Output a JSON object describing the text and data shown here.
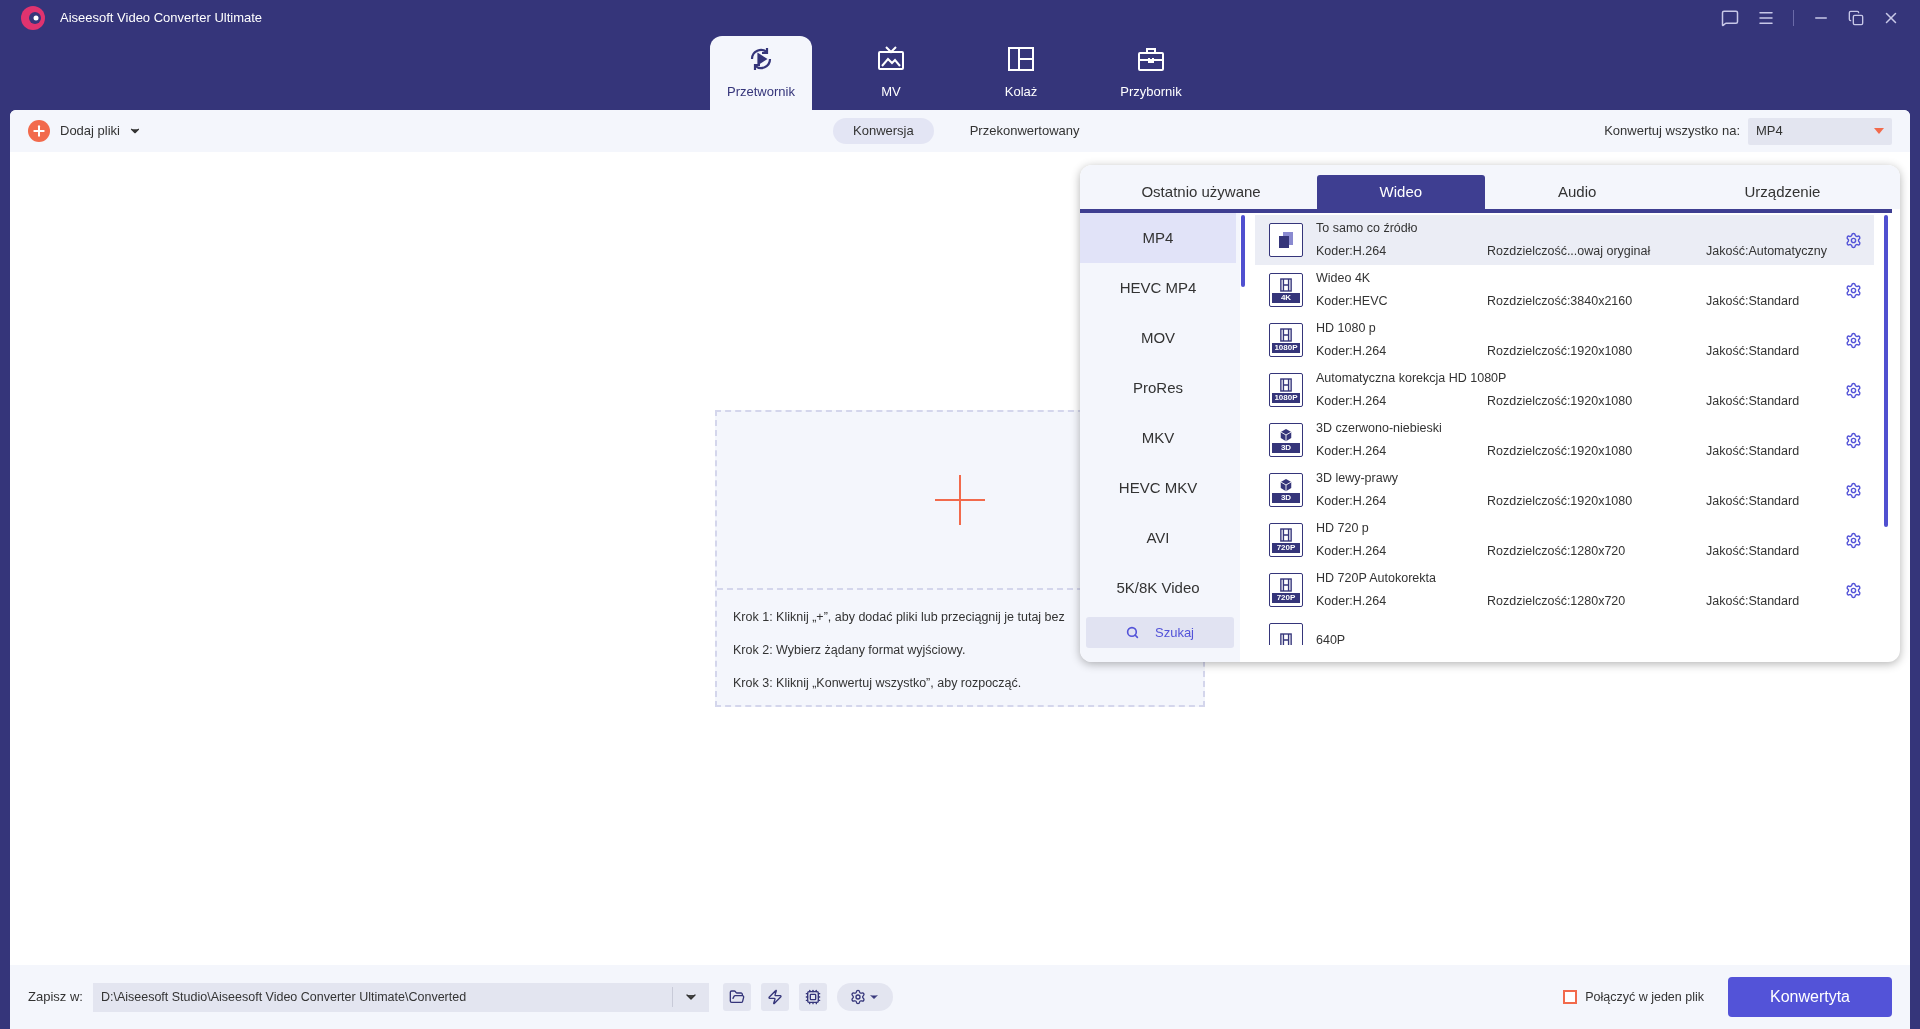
{
  "window": {
    "title": "Aiseesoft Video Converter Ultimate"
  },
  "nav_tabs": [
    {
      "label": "Przetwornik",
      "kind": "convert",
      "selected": true
    },
    {
      "label": "MV",
      "kind": "tv",
      "selected": false
    },
    {
      "label": "Kolaż",
      "kind": "collage",
      "selected": false
    },
    {
      "label": "Przybornik",
      "kind": "toolbox",
      "selected": false
    }
  ],
  "toolbar": {
    "add_files": "Dodaj pliki",
    "mode_tabs": [
      {
        "label": "Konwersja",
        "selected": true
      },
      {
        "label": "Przekonwertowany",
        "selected": false
      }
    ],
    "convert_all_label": "Konwertuj wszystko na:",
    "convert_all_value": "MP4"
  },
  "drop_zone": {
    "steps": [
      "Krok 1: Kliknij „+”, aby dodać pliki lub przeciągnij je tutaj bez",
      "Krok 2: Wybierz żądany format wyjściowy.",
      "Krok 3: Kliknij „Konwertuj wszystko”, aby rozpocząć."
    ]
  },
  "format_popup": {
    "tabs": [
      {
        "label": "Ostatnio używane",
        "selected": false
      },
      {
        "label": "Wideo",
        "selected": true
      },
      {
        "label": "Audio",
        "selected": false
      },
      {
        "label": "Urządzenie",
        "selected": false
      }
    ],
    "formats": [
      {
        "label": "MP4",
        "selected": true
      },
      {
        "label": "HEVC MP4",
        "selected": false
      },
      {
        "label": "MOV",
        "selected": false
      },
      {
        "label": "ProRes",
        "selected": false
      },
      {
        "label": "MKV",
        "selected": false
      },
      {
        "label": "HEVC MKV",
        "selected": false
      },
      {
        "label": "AVI",
        "selected": false
      },
      {
        "label": "5K/8K Video",
        "selected": false
      }
    ],
    "search": "Szukaj",
    "presets": [
      {
        "kind": "copy",
        "title": "To samo co źródło",
        "encoder": "Koder:H.264",
        "resolution": "Rozdzielczość...owaj oryginał",
        "quality": "Jakość:Automatyczny",
        "selected": true
      },
      {
        "kind": "film",
        "badge": "4K",
        "title": "Wideo 4K",
        "encoder": "Koder:HEVC",
        "resolution": "Rozdzielczość:3840x2160",
        "quality": "Jakość:Standard",
        "selected": false
      },
      {
        "kind": "film",
        "badge": "1080P",
        "title": "HD 1080 p",
        "encoder": "Koder:H.264",
        "resolution": "Rozdzielczość:1920x1080",
        "quality": "Jakość:Standard",
        "selected": false
      },
      {
        "kind": "film",
        "badge": "1080P",
        "title": "Automatyczna korekcja HD 1080P",
        "encoder": "Koder:H.264",
        "resolution": "Rozdzielczość:1920x1080",
        "quality": "Jakość:Standard",
        "selected": false
      },
      {
        "kind": "cube",
        "badge": "3D",
        "title": "3D czerwono-niebieski",
        "encoder": "Koder:H.264",
        "resolution": "Rozdzielczość:1920x1080",
        "quality": "Jakość:Standard",
        "selected": false
      },
      {
        "kind": "cube",
        "badge": "3D",
        "title": "3D lewy-prawy",
        "encoder": "Koder:H.264",
        "resolution": "Rozdzielczość:1920x1080",
        "quality": "Jakość:Standard",
        "selected": false
      },
      {
        "kind": "film",
        "badge": "720P",
        "title": "HD 720 p",
        "encoder": "Koder:H.264",
        "resolution": "Rozdzielczość:1280x720",
        "quality": "Jakość:Standard",
        "selected": false
      },
      {
        "kind": "film",
        "badge": "720P",
        "title": "HD 720P Autokorekta",
        "encoder": "Koder:H.264",
        "resolution": "Rozdzielczość:1280x720",
        "quality": "Jakość:Standard",
        "selected": false
      },
      {
        "kind": "film",
        "title": "640P",
        "selected": false
      }
    ]
  },
  "bottom_bar": {
    "save_label": "Zapisz w:",
    "save_path": "D:\\Aiseesoft Studio\\Aiseesoft Video Converter Ultimate\\Converted",
    "merge": {
      "label": "Połączyć w jeden plik",
      "checked": false
    },
    "convert_button": "Konwertyta"
  }
}
